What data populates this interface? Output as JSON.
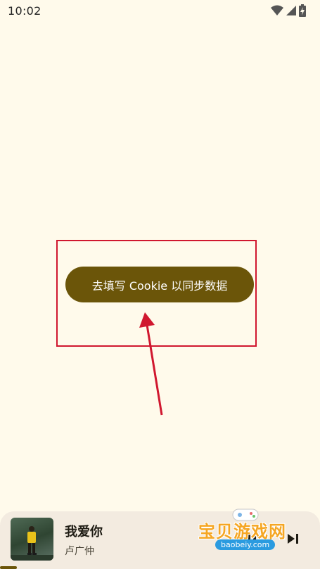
{
  "status_bar": {
    "time": "10:02",
    "icons": [
      "wifi-icon",
      "signal-icon",
      "battery-charging-icon"
    ]
  },
  "main": {
    "cookie_button_label": "去填写 Cookie 以同步数据"
  },
  "player": {
    "song_title": "我爱你",
    "artist": "卢广仲",
    "controls": [
      "play-pause-icon",
      "skip-next-icon"
    ]
  },
  "watermark": {
    "text": "宝贝游戏网",
    "url": "baobeiy.com"
  },
  "colors": {
    "background": "#fffaeb",
    "accent": "#6b5509",
    "annotation": "#d0172f",
    "player_bg": "#f3ebe0"
  }
}
